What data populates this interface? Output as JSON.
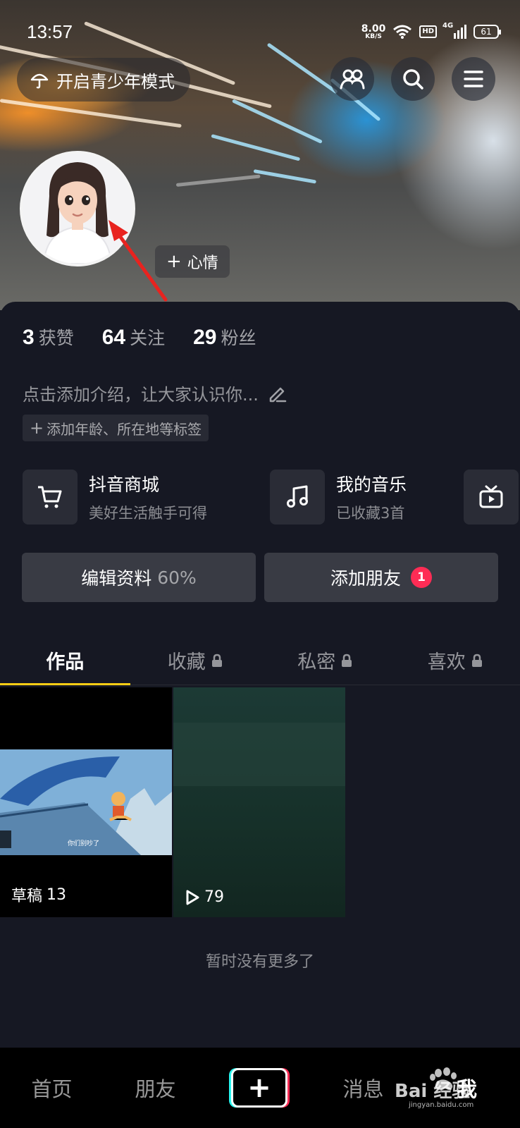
{
  "status_bar": {
    "time": "13:57",
    "net_speed": "8.00",
    "net_unit": "KB/S",
    "hd": "HD",
    "signal": "4G",
    "battery": "61"
  },
  "header": {
    "teen_mode_label": "开启青少年模式"
  },
  "profile": {
    "mood_label": "心情",
    "stats": [
      {
        "value": "3",
        "label": "获赞"
      },
      {
        "value": "64",
        "label": "关注"
      },
      {
        "value": "29",
        "label": "粉丝"
      }
    ],
    "bio_placeholder": "点击添加介绍，让大家认识你...",
    "tag_button": "添加年龄、所在地等标签"
  },
  "entries": [
    {
      "title": "抖音商城",
      "subtitle": "美好生活触手可得",
      "icon": "cart-icon"
    },
    {
      "title": "我的音乐",
      "subtitle": "已收藏3首",
      "icon": "music-note-icon"
    },
    {
      "icon": "tv-icon"
    }
  ],
  "actions": {
    "edit_profile": "编辑资料",
    "edit_progress": "60%",
    "add_friend": "添加朋友",
    "add_friend_badge": "1"
  },
  "tabs": [
    {
      "label": "作品",
      "locked": false,
      "active": true
    },
    {
      "label": "收藏",
      "locked": true,
      "active": false
    },
    {
      "label": "私密",
      "locked": true,
      "active": false
    },
    {
      "label": "喜欢",
      "locked": true,
      "active": false
    }
  ],
  "videos": [
    {
      "caption_label": "草稿",
      "caption_count": "13",
      "subtitle_text": "你们别吵了"
    },
    {
      "play_count": "79"
    }
  ],
  "no_more_text": "暂时没有更多了",
  "bottom_nav": {
    "home": "首页",
    "friends": "朋友",
    "messages": "消息",
    "me": "我"
  },
  "watermark": {
    "text": "Bai 经验",
    "sub": "jingyan.baidu.com"
  },
  "colors": {
    "accent_yellow": "#face15",
    "badge_red": "#fe2c55",
    "background": "#161823",
    "tiktok_cyan": "#25f4ee"
  }
}
